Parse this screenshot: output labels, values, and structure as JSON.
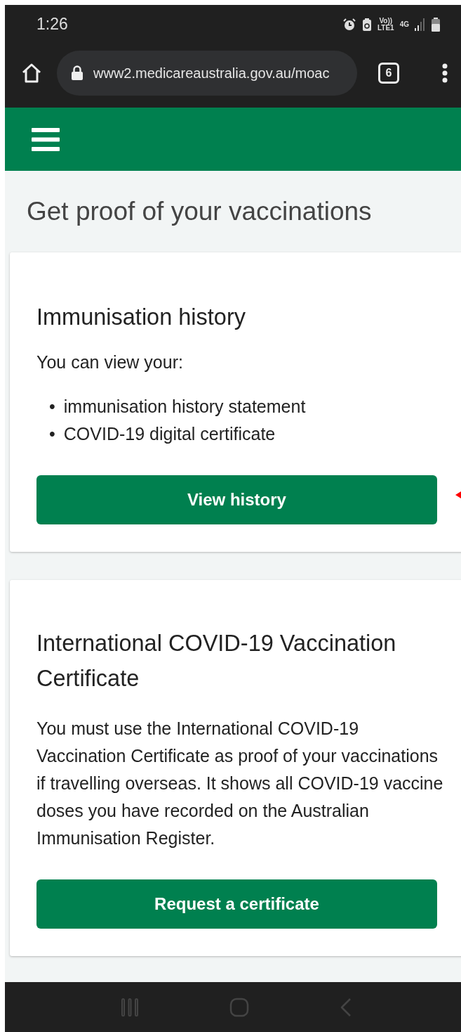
{
  "status_bar": {
    "time": "1:26",
    "indicators": [
      "Vo))",
      "LTE1",
      "4G"
    ]
  },
  "browser": {
    "url": "www2.medicareaustralia.gov.au/moac",
    "tab_count": "6"
  },
  "page": {
    "title": "Get proof of your vaccinations",
    "cards": [
      {
        "heading": "Immunisation history",
        "paragraph": "You can view your:",
        "bullets": [
          {
            "marker": "•",
            "text": "immunisation history statement"
          },
          {
            "marker": "•",
            "text": "COVID-19 digital certificate"
          }
        ],
        "button": "View history",
        "pointer": true
      },
      {
        "heading": "International COVID-19 Vaccination Certificate",
        "paragraph": "You must use the International COVID-19 Vaccination Certificate as proof of your vaccinations if travelling overseas. It shows all COVID-19 vaccine doses you have recorded on the Australian Immunisation Register.",
        "button": "Request a certificate",
        "pointer": false
      }
    ]
  }
}
